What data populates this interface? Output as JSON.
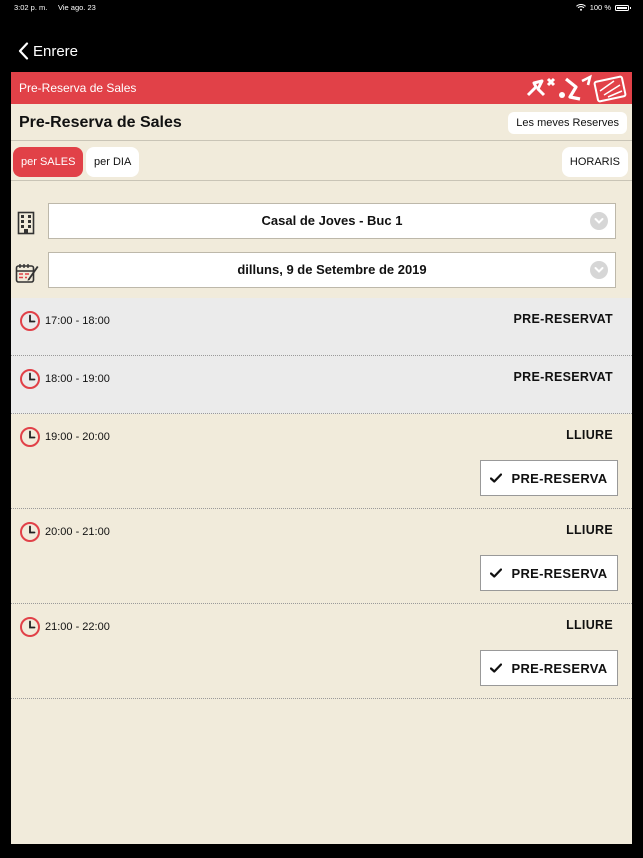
{
  "status_bar": {
    "time": "3:02 p. m.",
    "date": "Vie ago. 23",
    "battery": "100 %",
    "icons": [
      "wifi-icon",
      "battery-icon"
    ]
  },
  "nav": {
    "back_label": "Enrere"
  },
  "app_header": {
    "title": "Pre-Reserva de Sales"
  },
  "page": {
    "title": "Pre-Reserva de Sales",
    "my_reservations_label": "Les meves Reserves"
  },
  "tabs": {
    "by_room": "per SALES",
    "by_day": "per DIA",
    "schedules": "HORARIS"
  },
  "filters": {
    "room": "Casal de Joves - Buc 1",
    "date": "dilluns, 9 de Setembre de 2019"
  },
  "slots": [
    {
      "time": "17:00 - 18:00",
      "status": "PRE-RESERVAT"
    },
    {
      "time": "18:00 - 19:00",
      "status": "PRE-RESERVAT"
    },
    {
      "time": "19:00 - 20:00",
      "status": "LLIURE",
      "action": "PRE-RESERVA"
    },
    {
      "time": "20:00 - 21:00",
      "status": "LLIURE",
      "action": "PRE-RESERVA"
    },
    {
      "time": "21:00 - 22:00",
      "status": "LLIURE",
      "action": "PRE-RESERVA"
    }
  ],
  "colors": {
    "accent": "#e14148",
    "background": "#f1ebdb",
    "booked_row": "#ebebeb"
  }
}
